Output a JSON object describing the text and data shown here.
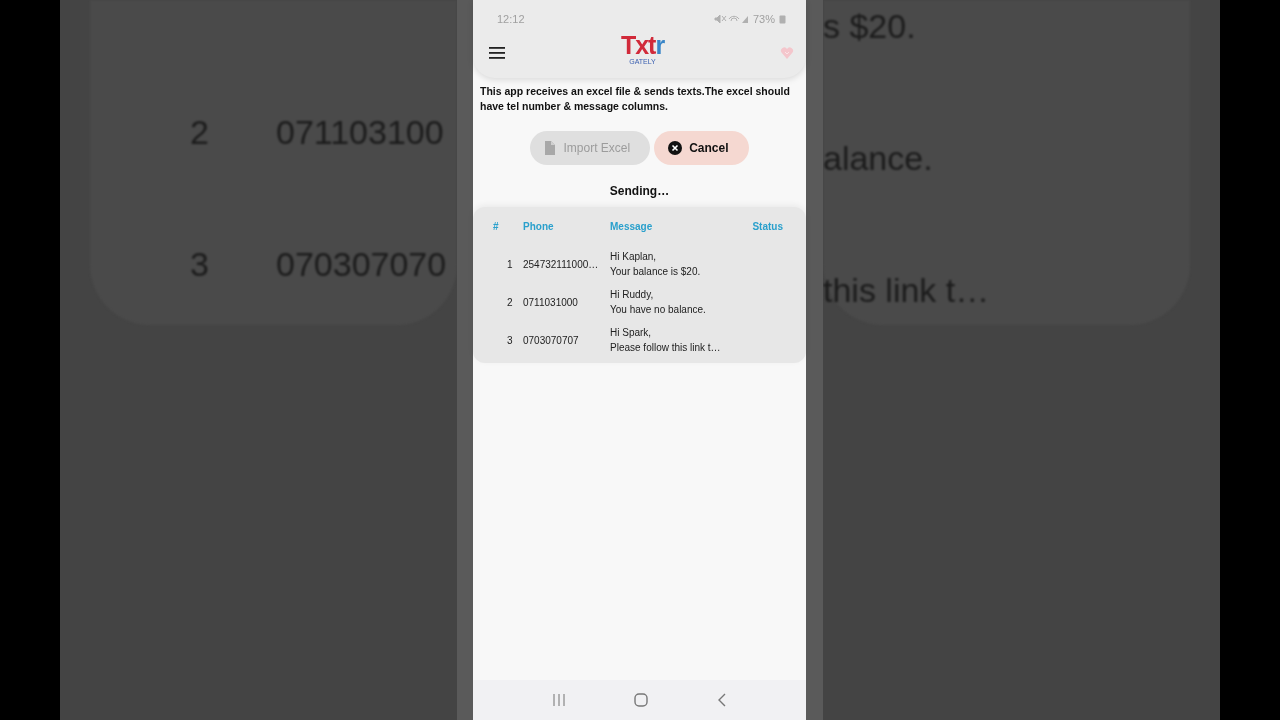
{
  "backdrop": {
    "left_rows": [
      {
        "index": "2",
        "phone": "071103100"
      },
      {
        "index": "3",
        "phone": "070307070"
      }
    ],
    "right_rows": [
      "s $20.",
      "alance.",
      "this link t…"
    ]
  },
  "status_bar": {
    "time": "12:12",
    "battery": "73%"
  },
  "app_bar": {
    "logo_parts": [
      {
        "text": "Txt",
        "color": "#d12a3a"
      },
      {
        "text": "r",
        "color": "#3a86c8"
      }
    ],
    "logo_subtitle": "GATELY"
  },
  "description": "This app receives an excel file & sends texts.The excel should have tel number & message columns.",
  "buttons": [
    {
      "label": "Import Excel",
      "kind": "import",
      "disabled": true
    },
    {
      "label": "Cancel",
      "kind": "cancel",
      "disabled": false
    }
  ],
  "status_text": "Sending…",
  "table": {
    "columns": [
      "#",
      "Phone",
      "Message",
      "Status"
    ],
    "rows": [
      {
        "index": "1",
        "phone": "254732111000…",
        "message": "Hi Kaplan,\nYour balance is $20."
      },
      {
        "index": "2",
        "phone": "0711031000",
        "message": "Hi Ruddy,\nYou have no balance."
      },
      {
        "index": "3",
        "phone": "0703070707",
        "message": "Hi Spark,\nPlease follow this link t…"
      }
    ]
  }
}
